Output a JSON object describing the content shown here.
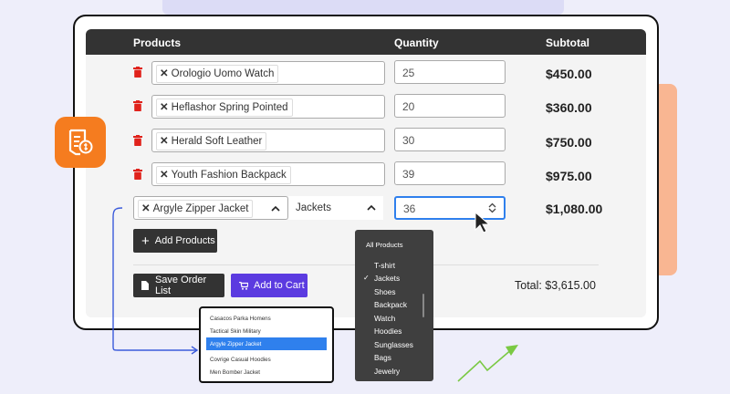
{
  "table": {
    "headers": {
      "products": "Products",
      "quantity": "Quantity",
      "subtotal": "Subtotal"
    },
    "rows": [
      {
        "product": "Orologio Uomo Watch",
        "quantity": "25",
        "subtotal": "$450.00"
      },
      {
        "product": "Heflashor Spring Pointed",
        "quantity": "20",
        "subtotal": "$360.00"
      },
      {
        "product": "Herald Soft Leather",
        "quantity": "30",
        "subtotal": "$750.00"
      },
      {
        "product": "Youth Fashion Backpack",
        "quantity": "39",
        "subtotal": "$975.00"
      }
    ],
    "active_row": {
      "product": "Argyle Zipper Jacket",
      "category": "Jackets",
      "quantity": "36",
      "subtotal": "$1,080.00"
    }
  },
  "buttons": {
    "add_products": "Add Products",
    "save_order": "Save Order List",
    "add_to_cart": "Add to Cart"
  },
  "total": "Total: $3,615.00",
  "category_dropdown": {
    "items": [
      "All Products",
      "T-shirt",
      "Jackets",
      "Shoes",
      "Backpack",
      "Watch",
      "Hoodies",
      "Sunglasses",
      "Bags",
      "Jewelry"
    ],
    "selected": "Jackets"
  },
  "product_popup": {
    "items": [
      "Casacos Parka Homens",
      "Tactical Skin Military",
      "Argyle Zipper Jacket",
      "Covrige Casual Hoodies",
      "Men Bomber Jacket"
    ],
    "selected": "Argyle Zipper Jacket"
  },
  "colors": {
    "accent": "#5b3be0",
    "trash": "#e0221b",
    "orange": "#f57c1f",
    "highlight": "#2f80ed",
    "dark": "#333333",
    "arrow": "#7ac943"
  }
}
